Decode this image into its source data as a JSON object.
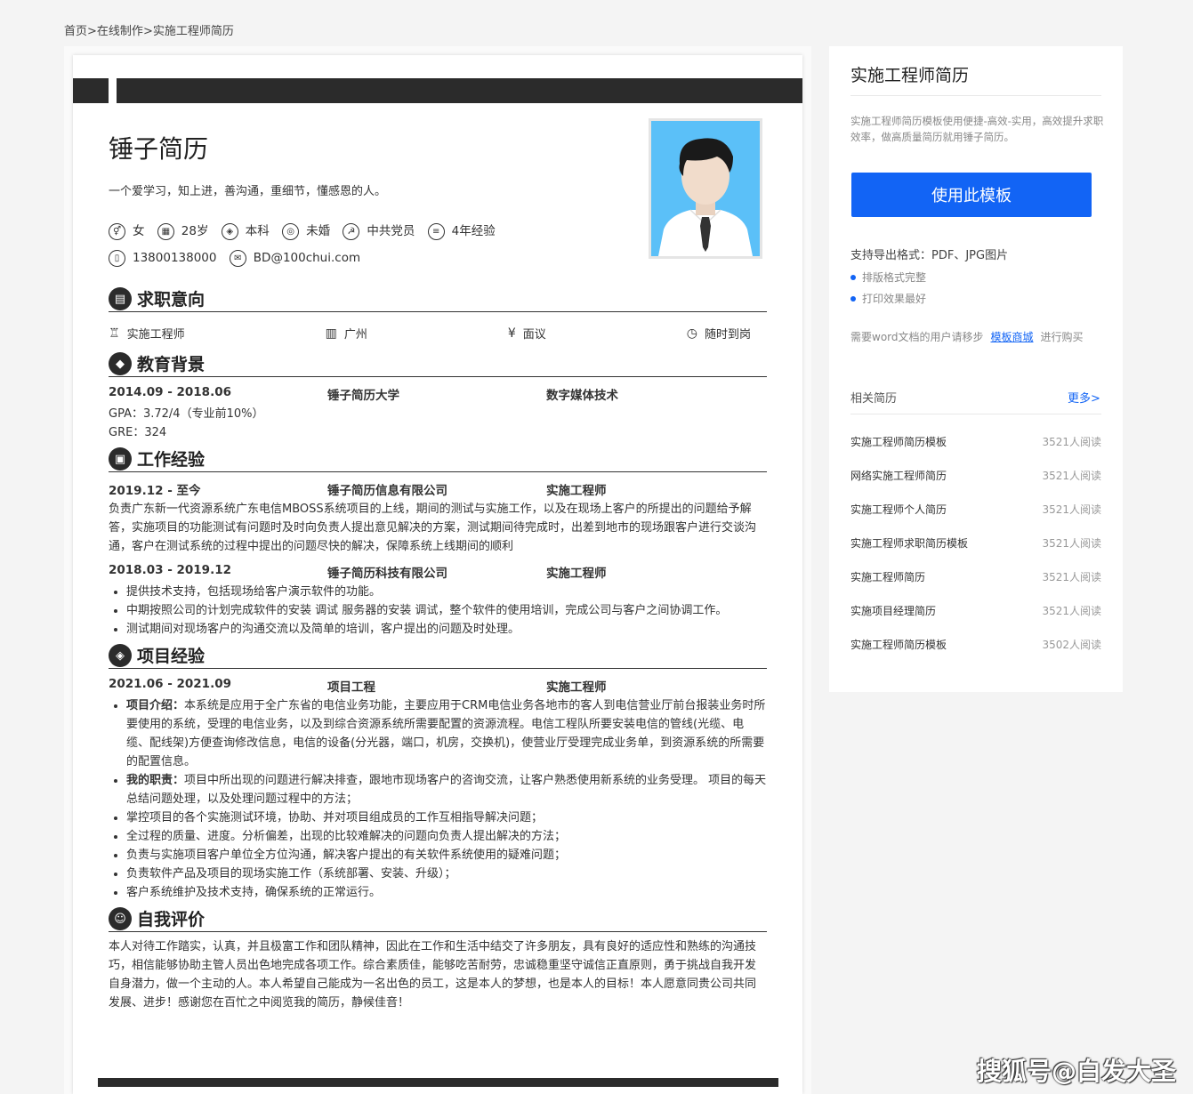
{
  "breadcrumb": {
    "home": "首页",
    "sep": ">",
    "online": "在线制作",
    "current": "实施工程师简历"
  },
  "resume": {
    "name": "锤子简历",
    "motto": "一个爱学习，知上进，善沟通，重细节，懂感恩的人。",
    "info": [
      {
        "icon": "gender-icon",
        "glyph": "⚥",
        "text": "女"
      },
      {
        "icon": "age-icon",
        "glyph": "▦",
        "text": "28岁"
      },
      {
        "icon": "education-icon",
        "glyph": "◈",
        "text": "本科"
      },
      {
        "icon": "marriage-icon",
        "glyph": "◎",
        "text": "未婚"
      },
      {
        "icon": "party-icon",
        "glyph": "☭",
        "text": "中共党员"
      },
      {
        "icon": "experience-icon",
        "glyph": "≡",
        "text": "4年经验"
      },
      {
        "icon": "phone-icon",
        "glyph": "▯",
        "text": "13800138000"
      },
      {
        "icon": "email-icon",
        "glyph": "✉",
        "text": "BD@100chui.com"
      }
    ],
    "sections": {
      "intent": "求职意向",
      "education": "教育背景",
      "work": "工作经验",
      "project": "项目经验",
      "self": "自我评价"
    },
    "intent": {
      "position": "实施工程师",
      "city": "广州",
      "salary": "面议",
      "availability": "随时到岗"
    },
    "education": {
      "date": "2014.09 - 2018.06",
      "school": "锤子简历大学",
      "major": "数字媒体技术",
      "gpa": "GPA：3.72/4（专业前10%）",
      "gre": "GRE：324"
    },
    "work": [
      {
        "date": "2019.12 - 至今",
        "company": "锤子简历信息有限公司",
        "role": "实施工程师",
        "desc": "负责广东新一代资源系统广东电信MBOSS系统项目的上线，期间的测试与实施工作，以及在现场上客户的所提出的问题给予解答，实施项目的功能测试有问题时及时向负责人提出意见解决的方案，测试期间待完成时，出差到地市的现场跟客户进行交谈沟通，客户在测试系统的过程中提出的问题尽快的解决，保障系统上线期间的顺利"
      },
      {
        "date": "2018.03 - 2019.12",
        "company": "锤子简历科技有限公司",
        "role": "实施工程师",
        "bullets": [
          "提供技术支持，包括现场给客户演示软件的功能。",
          "中期按照公司的计划完成软件的安装 调试 服务器的安装 调试，整个软件的使用培训，完成公司与客户之间协调工作。",
          "测试期间对现场客户的沟通交流以及简单的培训，客户提出的问题及时处理。"
        ]
      }
    ],
    "project": {
      "date": "2021.06 - 2021.09",
      "name": "项目工程",
      "role": "实施工程师",
      "intro_label": "项目介绍：",
      "intro": "本系统是应用于全广东省的电信业务功能，主要应用于CRM电信业务各地市的客人到电信营业厅前台报装业务时所要使用的系统，受理的电信业务，以及到综合资源系统所需要配置的资源流程。电信工程队所要安装电信的管线(光缆、电缆、配线架)方便查询修改信息，电信的设备(分光器，端口，机房，交换机)，使营业厅受理完成业务单，到资源系统的所需要的配置信息。",
      "duty_label": "我的职责：",
      "duty": "项目中所出现的问题进行解决排查，跟地市现场客户的咨询交流，让客户熟悉使用新系统的业务受理。 项目的每天总结问题处理，以及处理问题过程中的方法；",
      "bullets": [
        "掌控项目的各个实施测试环境，协助、并对项目组成员的工作互相指导解决问题；",
        "全过程的质量、进度。分析偏差，出现的比较难解决的问题向负责人提出解决的方法；",
        "负责与实施项目客户单位全方位沟通，解决客户提出的有关软件系统使用的疑难问题；",
        "负责软件产品及项目的现场实施工作（系统部署、安装、升级）；",
        "客户系统维护及技术支持，确保系统的正常运行。"
      ]
    },
    "self": "本人对待工作踏实，认真，并且极富工作和团队精神，因此在工作和生活中结交了许多朋友，具有良好的适应性和熟练的沟通技巧，相信能够协助主管人员出色地完成各项工作。综合素质佳，能够吃苦耐劳，忠诚稳重坚守诚信正直原则，勇于挑战自我开发自身潜力，做一个主动的人。本人希望自己能成为一名出色的员工，这是本人的梦想，也是本人的目标！本人愿意同贵公司共同发展、进步！感谢您在百忙之中阅览我的简历，静候佳音！"
  },
  "sidebar": {
    "title": "实施工程师简历",
    "desc": "实施工程师简历模板使用便捷-高效-实用，高效提升求职效率，做高质量简历就用锤子简历。",
    "use_button": "使用此模板",
    "export": "支持导出格式：PDF、JPG图片",
    "features": [
      "排版格式完整",
      "打印效果最好"
    ],
    "word_prefix": "需要word文档的用户请移步",
    "word_link": "模板商城",
    "word_suffix": "进行购买",
    "related_title": "相关简历",
    "more": "更多>",
    "related": [
      {
        "title": "实施工程师简历模板",
        "count": "3521人阅读"
      },
      {
        "title": "网络实施工程师简历",
        "count": "3521人阅读"
      },
      {
        "title": "实施工程师个人简历",
        "count": "3521人阅读"
      },
      {
        "title": "实施工程师求职简历模板",
        "count": "3521人阅读"
      },
      {
        "title": "实施工程师简历",
        "count": "3521人阅读"
      },
      {
        "title": "实施项目经理简历",
        "count": "3521人阅读"
      },
      {
        "title": "实施工程师简历模板",
        "count": "3502人阅读"
      }
    ]
  },
  "watermark": "搜狐号@白发大圣",
  "colors": {
    "accent": "#1264f5",
    "dark": "#2b2b2b"
  }
}
